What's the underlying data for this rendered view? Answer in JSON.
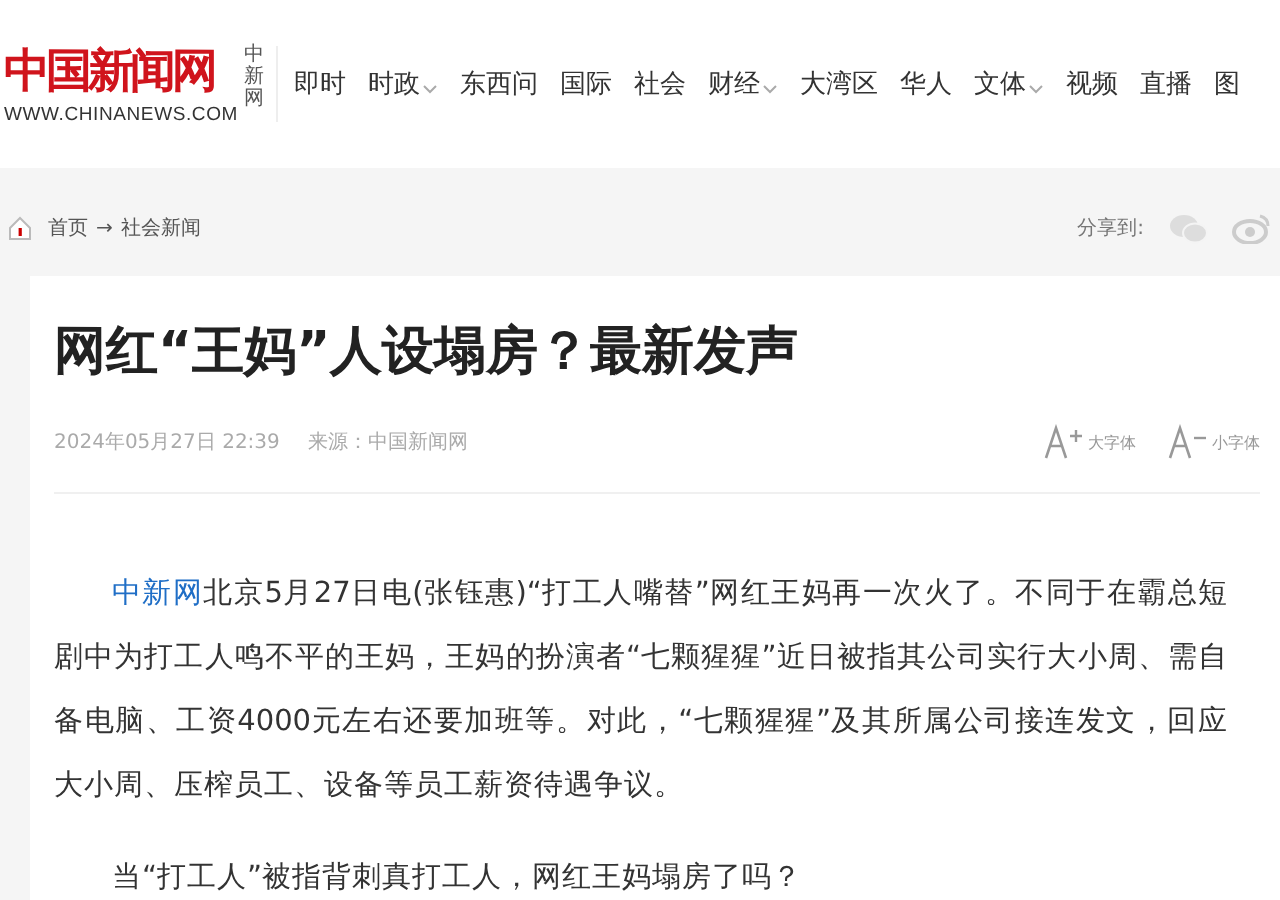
{
  "header": {
    "logo": {
      "title": "中国新闻网",
      "side": "中新网",
      "url": "WWW.CHINANEWS.COM"
    },
    "nav": [
      {
        "label": "即时",
        "dropdown": false
      },
      {
        "label": "时政",
        "dropdown": true
      },
      {
        "label": "东西问",
        "dropdown": false
      },
      {
        "label": "国际",
        "dropdown": false
      },
      {
        "label": "社会",
        "dropdown": false
      },
      {
        "label": "财经",
        "dropdown": true
      },
      {
        "label": "大湾区",
        "dropdown": false
      },
      {
        "label": "华人",
        "dropdown": false
      },
      {
        "label": "文体",
        "dropdown": true
      },
      {
        "label": "视频",
        "dropdown": false
      },
      {
        "label": "直播",
        "dropdown": false
      },
      {
        "label": "图",
        "dropdown": false
      }
    ]
  },
  "breadcrumb": {
    "items": [
      "首页",
      "社会新闻"
    ],
    "separator": "→"
  },
  "share": {
    "label": "分享到:"
  },
  "article": {
    "title": "网红“王妈”人设塌房？最新发声",
    "meta": {
      "date": "2024年05月27日 22:39",
      "source": "来源：中国新闻网"
    },
    "font_controls": [
      {
        "kind": "larger",
        "label": "大字体"
      },
      {
        "kind": "smaller",
        "label": "小字体"
      }
    ],
    "paragraphs": [
      {
        "lead_link": "中新网",
        "text": "北京5月27日电(张钰惠)“打工人嘴替”网红王妈再一次火了。不同于在霸总短剧中为打工人鸣不平的王妈，王妈的扮演者“七颗猩猩”近日被指其公司实行大小周、需自备电脑、工资4000元左右还要加班等。对此，“七颗猩猩”及其所属公司接连发文，回应大小周、压榨员工、设备等员工薪资待遇争议。"
      },
      {
        "text": "当“打工人”被指背刺真打工人，网红王妈塌房了吗？"
      }
    ]
  }
}
